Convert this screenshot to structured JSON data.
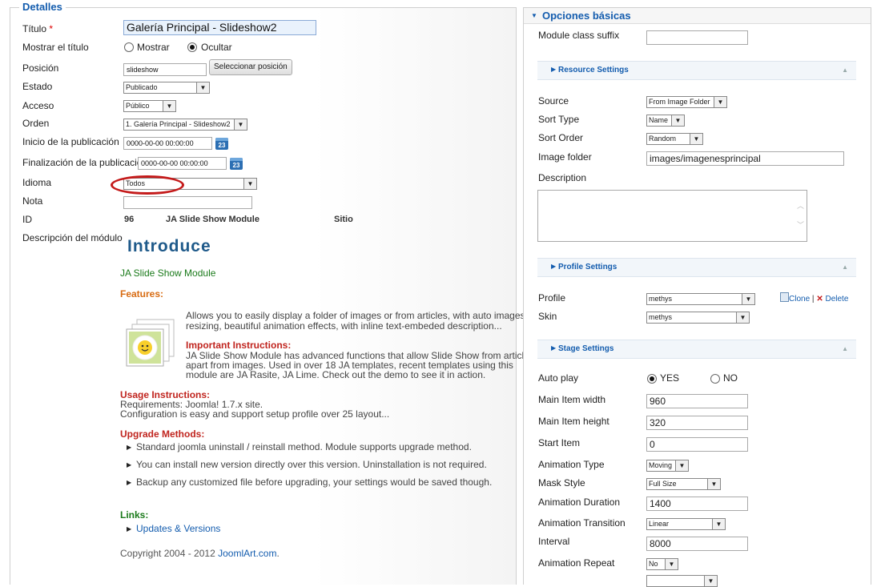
{
  "details": {
    "legend": "Detalles",
    "titulo_label": "Título",
    "titulo_required": "*",
    "titulo_value": "Galería Principal - Slideshow2",
    "mostrar_titulo_label": "Mostrar el título",
    "mostrar_option": "Mostrar",
    "ocultar_option": "Ocultar",
    "posicion_label": "Posición",
    "posicion_value": "slideshow",
    "seleccionar_posicion": "Seleccionar posición",
    "estado_label": "Estado",
    "estado_value": "Publicado",
    "acceso_label": "Acceso",
    "acceso_value": "Público",
    "orden_label": "Orden",
    "orden_value": "1. Galería Principal - Slideshow2",
    "inicio_label": "Inicio de la publicación",
    "inicio_value": "0000-00-00 00:00:00",
    "fin_label": "Finalización de la publicación",
    "fin_value": "0000-00-00 00:00:00",
    "calendar_day": "23",
    "idioma_label": "Idioma",
    "idioma_value": "Todos",
    "nota_label": "Nota",
    "nota_value": "",
    "id_label": "ID",
    "id_value": "96",
    "module_type": "JA Slide Show Module",
    "sitio": "Sitio",
    "descripcion_label": "Descripción del módulo"
  },
  "description": {
    "introduce": "Introduce",
    "module_name": "JA Slide Show Module",
    "features": "Features:",
    "features_text_1": "Allows you to easily display a folder of images or from articles, with auto images",
    "features_text_2": "resizing, beautiful animation effects, with inline text-embeded description...",
    "important_title": "Important Instructions:",
    "important_text_1": "JA Slide Show Module has advanced functions that allow Slide Show from articles",
    "important_text_2": "apart from images. Used in over 18 JA templates, recent templates using this",
    "important_text_3": "module are JA Rasite, JA Lime. Check out the demo to see it in action.",
    "usage_title": "Usage Instructions:",
    "usage_text_1": "Requirements: Joomla! 1.7.x site.",
    "usage_text_2": "Configuration is easy and support setup profile over 25 layout...",
    "upgrade_title": "Upgrade Methods:",
    "upgrade_items": [
      "Standard joomla uninstall / reinstall method. Module supports upgrade method.",
      "You can install new version directly over this version. Uninstallation is not required.",
      "Backup any customized file before upgrading, your settings would be saved though."
    ],
    "links_title": "Links:",
    "links_item": "Updates & Versions",
    "copyright": "Copyright 2004 - 2012 ",
    "copyright_link": "JoomlArt.com",
    "copyright_end": "."
  },
  "options": {
    "header": "Opciones básicas",
    "module_class_suffix_label": "Module class suffix",
    "module_class_suffix_value": "",
    "resource_settings": "Resource Settings",
    "source_label": "Source",
    "source_value": "From Image Folder",
    "sort_type_label": "Sort Type",
    "sort_type_value": "Name",
    "sort_order_label": "Sort Order",
    "sort_order_value": "Random",
    "image_folder_label": "Image folder",
    "image_folder_value": "images/imagenesprincipal",
    "description_label": "Description",
    "profile_settings": "Profile Settings",
    "profile_label": "Profile",
    "profile_value": "methys",
    "clone_label": "Clone",
    "separator": "|",
    "delete_label": "Delete",
    "skin_label": "Skin",
    "skin_value": "methys",
    "stage_settings": "Stage Settings",
    "auto_play_label": "Auto play",
    "yes_label": "YES",
    "no_label": "NO",
    "main_item_width_label": "Main Item width",
    "main_item_width_value": "960",
    "main_item_height_label": "Main Item height",
    "main_item_height_value": "320",
    "start_item_label": "Start Item",
    "start_item_value": "0",
    "animation_type_label": "Animation Type",
    "animation_type_value": "Moving",
    "mask_style_label": "Mask Style",
    "mask_style_value": "Full Size",
    "animation_duration_label": "Animation Duration",
    "animation_duration_value": "1400",
    "animation_transition_label": "Animation Transition",
    "animation_transition_value": "Linear",
    "interval_label": "Interval",
    "interval_value": "8000",
    "animation_repeat_label": "Animation Repeat",
    "animation_repeat_value": "No"
  },
  "colors": {
    "accent": "#135cae",
    "annotation_red": "#c41a1a",
    "link_green": "#1a7a1a",
    "features_orange": "#d86c13",
    "instruction_red": "#c0241e"
  }
}
